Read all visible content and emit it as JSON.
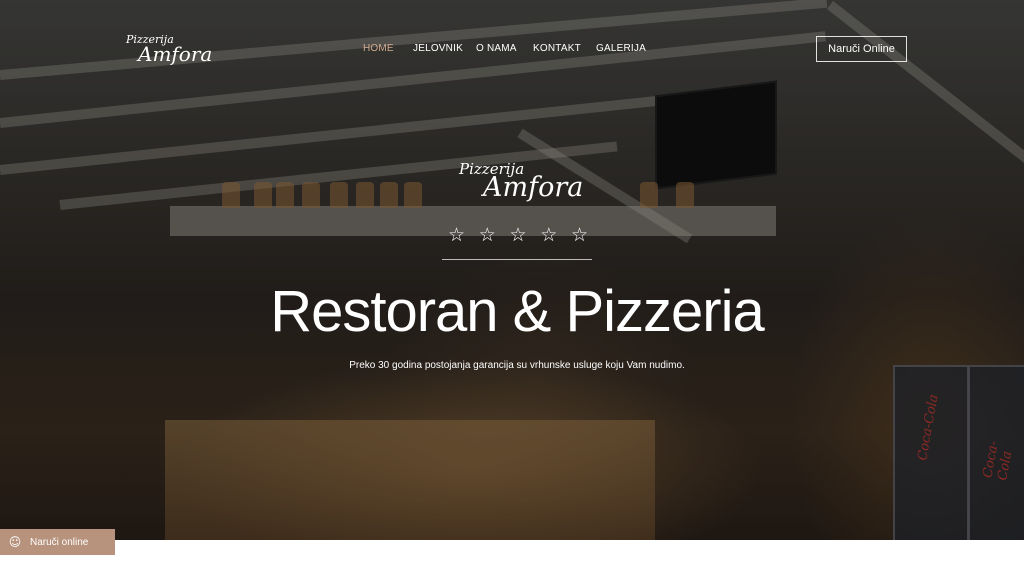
{
  "header": {
    "logo_small": "Pizzerija",
    "logo_big": "Amfora",
    "nav": [
      "HOME",
      "JELOVNIK",
      "O NAMA",
      "KONTAKT",
      "GALERIJA"
    ],
    "active_nav": "HOME",
    "order_label": "Naruči Online"
  },
  "hero": {
    "logo_small": "Pizzerija",
    "logo_big": "Amfora",
    "stars": [
      "☆",
      "☆",
      "☆",
      "☆",
      "☆"
    ],
    "headline": "Restoran & Pizzeria",
    "subline": "Preko 30 godina postojanja garancija su vrhunske usluge koju Vam nudimo."
  },
  "float_button": {
    "icon": "☺",
    "label": "Naruči online"
  },
  "decor": {
    "fridge_label": "Coca-Cola"
  },
  "colors": {
    "accent": "#d3ab8f",
    "float_button": "#b7927c"
  }
}
